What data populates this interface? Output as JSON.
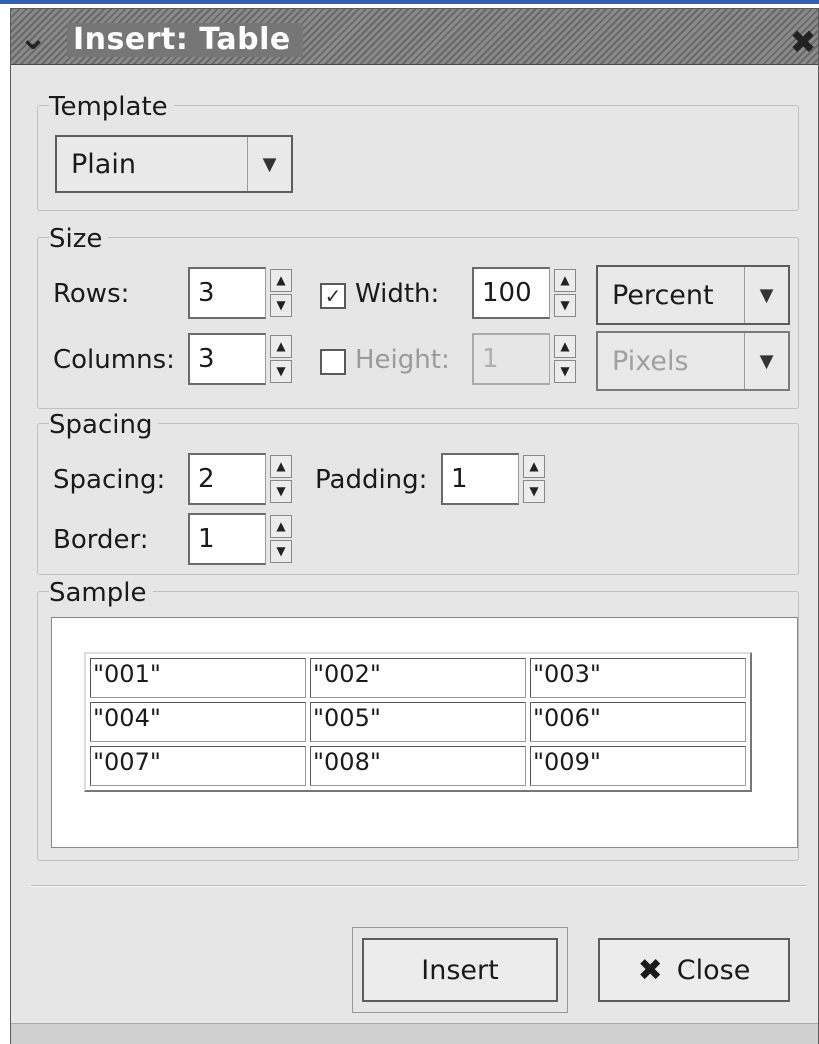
{
  "window": {
    "title": "Insert: Table",
    "menu_icon": "chevron-down-icon",
    "close_icon": "close-icon"
  },
  "template": {
    "group_label": "Template",
    "selected": "Plain"
  },
  "size": {
    "group_label": "Size",
    "rows_label": "Rows:",
    "rows_value": "3",
    "columns_label": "Columns:",
    "columns_value": "3",
    "width_label": "Width:",
    "width_checked": true,
    "width_value": "100",
    "width_unit": "Percent",
    "height_label": "Height:",
    "height_checked": false,
    "height_value": "1",
    "height_unit": "Pixels"
  },
  "spacing": {
    "group_label": "Spacing",
    "spacing_label": "Spacing:",
    "spacing_value": "2",
    "padding_label": "Padding:",
    "padding_value": "1",
    "border_label": "Border:",
    "border_value": "1"
  },
  "sample": {
    "group_label": "Sample",
    "rows": [
      [
        "\"001\"",
        "\"002\"",
        "\"003\""
      ],
      [
        "\"004\"",
        "\"005\"",
        "\"006\""
      ],
      [
        "\"007\"",
        "\"008\"",
        "\"009\""
      ]
    ]
  },
  "buttons": {
    "insert_label": "Insert",
    "close_label": "Close"
  }
}
